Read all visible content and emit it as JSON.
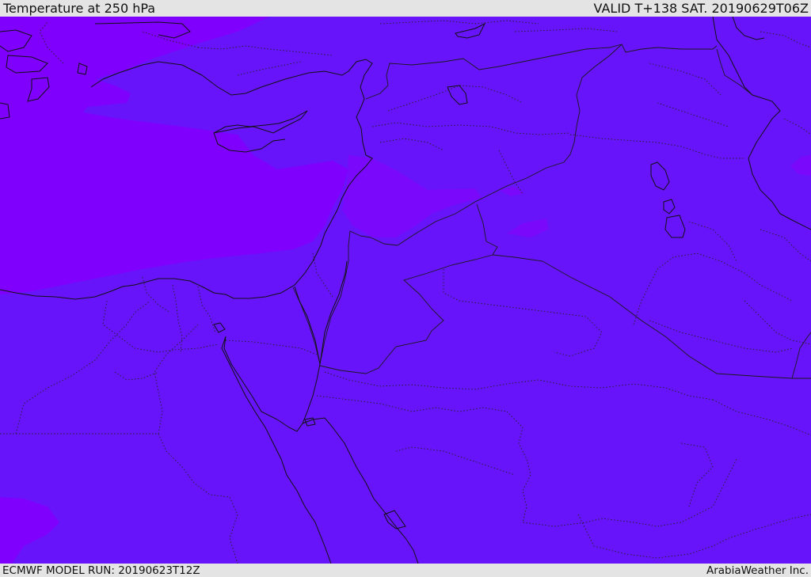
{
  "header": {
    "title": "Temperature at 250 hPa",
    "valid": "VALID T+138 SAT. 20190629T06Z"
  },
  "footer": {
    "model_run": "ECMWF MODEL RUN: 20190623T12Z",
    "credit": "ArabiaWeather Inc."
  },
  "map": {
    "colors": {
      "warm_band": "#6814fb",
      "cold_band": "#8000fd",
      "mid_band": "#7a08fa",
      "coastline": "#111111",
      "border": "#1a1a1a"
    }
  }
}
